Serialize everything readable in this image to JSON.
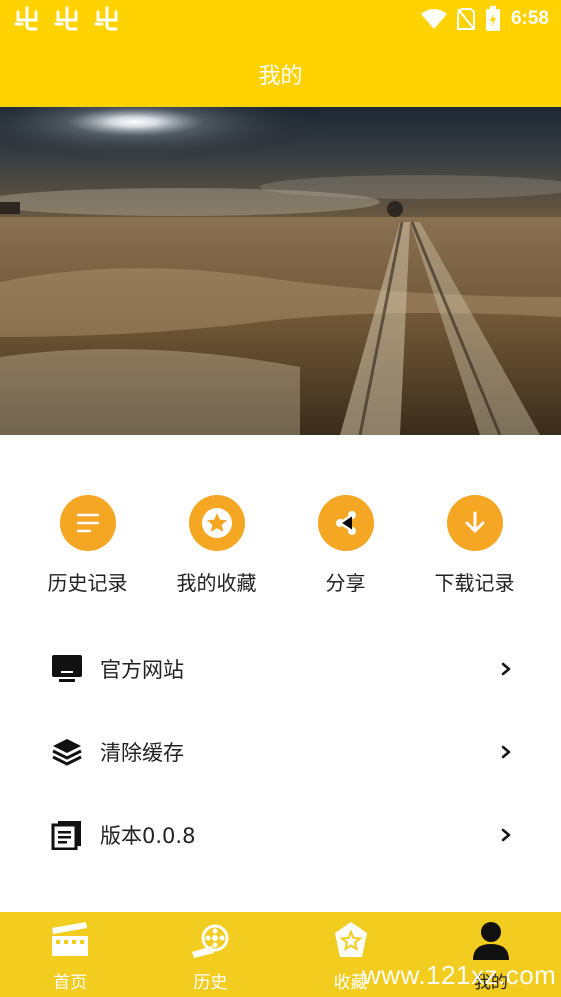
{
  "status_bar": {
    "time": "6:58",
    "left_icons": [
      "bug-icon",
      "bug-icon",
      "bug-icon"
    ],
    "right_icons": [
      "wifi-icon",
      "no-sim-icon",
      "battery-charging-icon"
    ]
  },
  "header": {
    "title": "我的"
  },
  "banner": {
    "image": "desert-landscape-with-sun-and-tire-tracks"
  },
  "quick_actions": [
    {
      "label": "历史记录",
      "icon": "list-icon"
    },
    {
      "label": "我的收藏",
      "icon": "star-icon"
    },
    {
      "label": "分享",
      "icon": "share-icon"
    },
    {
      "label": "下载记录",
      "icon": "download-icon"
    }
  ],
  "menu": [
    {
      "label": "官方网站",
      "icon": "monitor-icon"
    },
    {
      "label": "清除缓存",
      "icon": "layers-icon"
    },
    {
      "label": "版本0.0.8",
      "icon": "document-icon"
    }
  ],
  "tabs": [
    {
      "label": "首页",
      "icon": "clapperboard-icon",
      "active": false
    },
    {
      "label": "历史",
      "icon": "film-reel-icon",
      "active": false
    },
    {
      "label": "收藏",
      "icon": "star-badge-icon",
      "active": false
    },
    {
      "label": "我的",
      "icon": "user-icon",
      "active": true
    }
  ],
  "watermark": "www.121xz.com",
  "colors": {
    "primary": "#FFD200",
    "tab_bar": "#F2CC1F",
    "accent": "#F5A623"
  }
}
